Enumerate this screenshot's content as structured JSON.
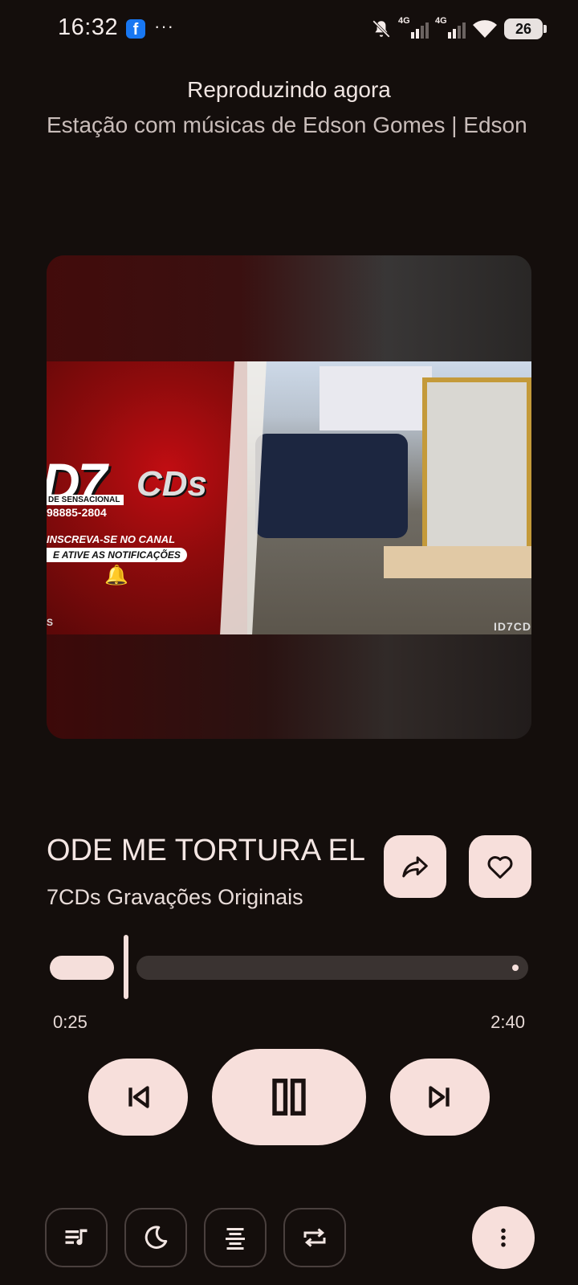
{
  "status_bar": {
    "time": "16:32",
    "facebook_icon": "f",
    "more": "···",
    "network1": "4G",
    "network2": "4G",
    "battery": "26"
  },
  "header": {
    "title": "Reproduzindo agora",
    "station": "Estação com músicas de Edson Gomes | Edson Gomes"
  },
  "artwork": {
    "logo_main": "D7",
    "logo_cds": "CDs",
    "logo_tagline": "DE SENSACIONAL",
    "logo_phone": "98885-2804",
    "subscribe": "INSCREVA-SE NO CANAL",
    "notify": "E ATIVE AS NOTIFICAÇÕES",
    "bell_icon": "🔔",
    "watermark_left": "S",
    "watermark_right": "ID7CD"
  },
  "track": {
    "title": "ODE ME TORTURA EL",
    "artist": "7CDs Gravações Originais"
  },
  "progress": {
    "elapsed": "0:25",
    "total": "2:40",
    "fraction": 0.156
  },
  "icons": {
    "share": "share-icon",
    "favorite": "heart-icon",
    "previous": "skip-previous-icon",
    "pause": "pause-icon",
    "next": "skip-next-icon",
    "queue": "queue-music-icon",
    "sleep": "moon-icon",
    "lyrics": "lyrics-icon",
    "repeat": "repeat-icon",
    "menu": "more-vert-icon"
  },
  "colors": {
    "background": "#140e0c",
    "accent": "#f7dfdb",
    "track_bg": "#3a3331"
  }
}
